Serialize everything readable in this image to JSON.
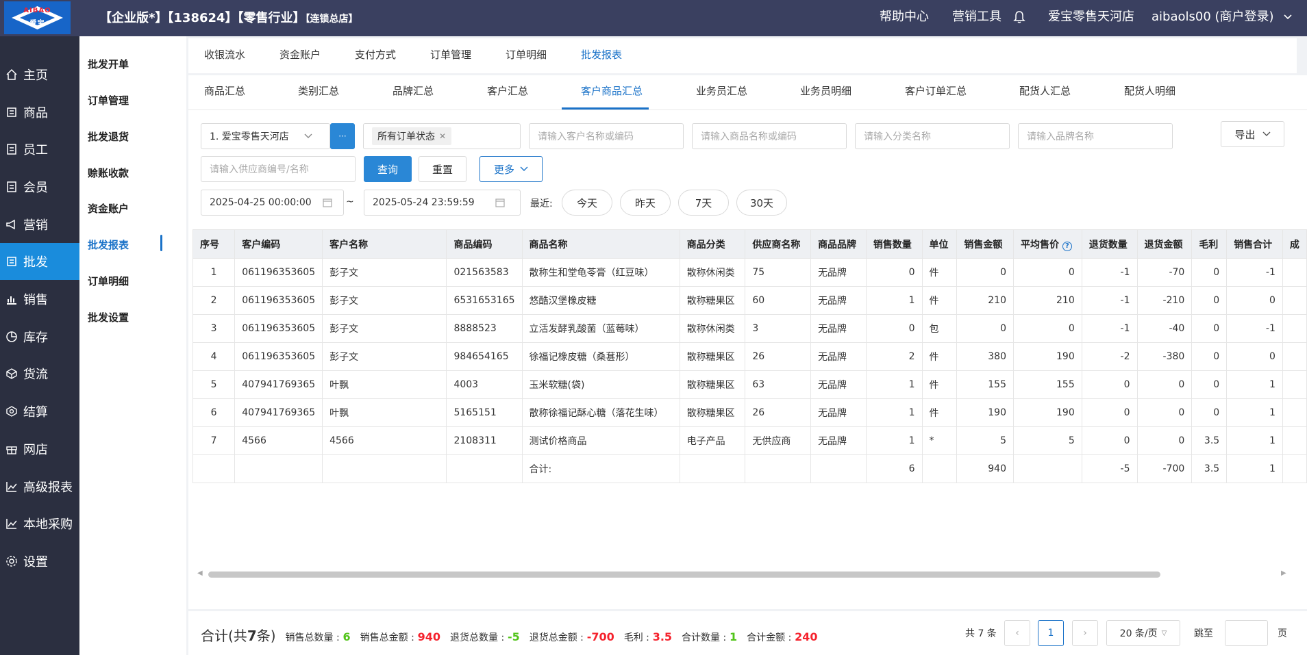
{
  "header": {
    "logo_top": "AIBAO",
    "logo_bottom": "爱宝",
    "title_main": "【企业版*】【138624】【零售行业】",
    "title_small": "【连锁总店】",
    "help": "帮助中心",
    "marketing": "营销工具",
    "store": "爱宝零售天河店",
    "user": "aibaols00 (商户登录)"
  },
  "mainnav": [
    {
      "label": "主页",
      "icon": "home-icon"
    },
    {
      "label": "商品",
      "icon": "goods-icon"
    },
    {
      "label": "员工",
      "icon": "staff-icon"
    },
    {
      "label": "会员",
      "icon": "member-icon"
    },
    {
      "label": "营销",
      "icon": "megaphone-icon"
    },
    {
      "label": "批发",
      "icon": "wholesale-icon"
    },
    {
      "label": "销售",
      "icon": "chart-icon"
    },
    {
      "label": "库存",
      "icon": "pie-icon"
    },
    {
      "label": "货流",
      "icon": "box-icon"
    },
    {
      "label": "结算",
      "icon": "settle-icon"
    },
    {
      "label": "网店",
      "icon": "gift-icon"
    },
    {
      "label": "高级报表",
      "icon": "trend-icon"
    },
    {
      "label": "本地采购",
      "icon": "trend-icon"
    },
    {
      "label": "设置",
      "icon": "gear-icon"
    }
  ],
  "subnav": [
    "批发开单",
    "订单管理",
    "批发退货",
    "赊账收款",
    "资金账户",
    "批发报表",
    "订单明细",
    "批发设置"
  ],
  "tabs1": [
    "收银流水",
    "资金账户",
    "支付方式",
    "订单管理",
    "订单明细",
    "批发报表"
  ],
  "tabs2": [
    "商品汇总",
    "类别汇总",
    "品牌汇总",
    "客户汇总",
    "客户商品汇总",
    "业务员汇总",
    "业务员明细",
    "客户订单汇总",
    "配货人汇总",
    "配货人明细"
  ],
  "filters": {
    "store_select": "1. 爱宝零售天河店",
    "more_dots": "···",
    "status_tag": "所有订单状态",
    "customer_ph": "请输入客户名称或编码",
    "goods_ph": "请输入商品名称或编码",
    "category_ph": "请输入分类名称",
    "brand_ph": "请输入品牌名称",
    "export": "导出",
    "supplier_ph": "请输入供应商编号/名称",
    "query": "查询",
    "reset": "重置",
    "more": "更多",
    "date_from": "2025-04-25 00:00:00",
    "date_sep": "~",
    "date_to": "2025-05-24 23:59:59",
    "recent_label": "最近:",
    "quick": [
      "今天",
      "昨天",
      "7天",
      "30天"
    ]
  },
  "table": {
    "headers": [
      "序号",
      "客户编码",
      "客户名称",
      "商品编码",
      "商品名称",
      "商品分类",
      "供应商名称",
      "商品品牌",
      "销售数量",
      "单位",
      "销售金额",
      "平均售价",
      "退货数量",
      "退货金额",
      "毛利",
      "销售合计",
      "成"
    ],
    "rows": [
      [
        "1",
        "061196353605",
        "彭子文",
        "021563583",
        "散称生和堂龟苓膏（红豆味）",
        "散称休闲类",
        "75",
        "无品牌",
        "0",
        "件",
        "0",
        "0",
        "-1",
        "-70",
        "0",
        "-1",
        ""
      ],
      [
        "2",
        "061196353605",
        "彭子文",
        "6531653165",
        "悠酷汉堡橡皮糖",
        "散称糖果区",
        "60",
        "无品牌",
        "1",
        "件",
        "210",
        "210",
        "-1",
        "-210",
        "0",
        "0",
        ""
      ],
      [
        "3",
        "061196353605",
        "彭子文",
        "8888523",
        "立活发酵乳酸菌（蓝莓味）",
        "散称休闲类",
        "3",
        "无品牌",
        "0",
        "包",
        "0",
        "0",
        "-1",
        "-40",
        "0",
        "-1",
        ""
      ],
      [
        "4",
        "061196353605",
        "彭子文",
        "984654165",
        "徐福记橡皮糖（桑葚形）",
        "散称糖果区",
        "26",
        "无品牌",
        "2",
        "件",
        "380",
        "190",
        "-2",
        "-380",
        "0",
        "0",
        ""
      ],
      [
        "5",
        "407941769365",
        "叶飘",
        "4003",
        "玉米软糖(袋)",
        "散称糖果区",
        "63",
        "无品牌",
        "1",
        "件",
        "155",
        "155",
        "0",
        "0",
        "0",
        "1",
        ""
      ],
      [
        "6",
        "407941769365",
        "叶飘",
        "5165151",
        "散称徐福记酥心糖（落花生味）",
        "散称糖果区",
        "26",
        "无品牌",
        "1",
        "件",
        "190",
        "190",
        "0",
        "0",
        "0",
        "1",
        ""
      ],
      [
        "7",
        "4566",
        "4566",
        "2108311",
        "测试价格商品",
        "电子产品",
        "无供应商",
        "无品牌",
        "1",
        "*",
        "5",
        "5",
        "0",
        "0",
        "3.5",
        "1",
        ""
      ]
    ],
    "total_row": [
      "",
      "",
      "",
      "",
      "合计:",
      "",
      "",
      "",
      "6",
      "",
      "940",
      "",
      "-5",
      "-700",
      "3.5",
      "1",
      ""
    ]
  },
  "footer": {
    "sum_prefix": "合计(共 ",
    "sum_count": "7",
    "sum_suffix": "条)",
    "sales_qty_label": "销售总数量 :",
    "sales_qty": "6",
    "sales_amt_label": "销售总金额 :",
    "sales_amt": "940",
    "ret_qty_label": "退货总数量 :",
    "ret_qty": "-5",
    "ret_amt_label": "退货总金额 :",
    "ret_amt": "-700",
    "profit_label": "毛利 :",
    "profit": "3.5",
    "total_qty_label": "合计数量 :",
    "total_qty": "1",
    "total_amt_label": "合计金额 :",
    "total_amt": "240",
    "total_records": "共 7 条",
    "page": "1",
    "page_size": "20 条/页",
    "goto": "跳至",
    "page_unit": "页"
  }
}
